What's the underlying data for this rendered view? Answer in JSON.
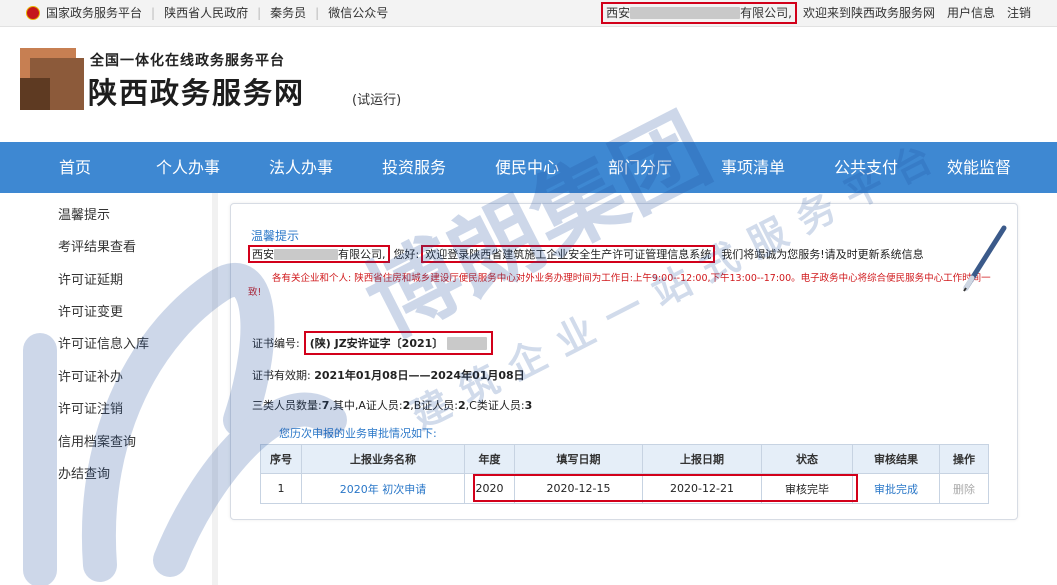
{
  "topbar": {
    "links": [
      "国家政务服务平台",
      "陕西省人民政府",
      "秦务员",
      "微信公众号"
    ],
    "company_prefix": "西安",
    "company_suffix": "有限公司,",
    "welcome": "欢迎来到陕西政务服务网",
    "user_info": "用户信息",
    "logout": "注销"
  },
  "header": {
    "subtitle": "全国一体化在线政务服务平台",
    "title": "陕西政务服务网",
    "trial": "(试运行)"
  },
  "nav": {
    "items": [
      "首页",
      "个人办事",
      "法人办事",
      "投资服务",
      "便民中心",
      "部门分厅",
      "事项清单",
      "公共支付",
      "效能监督"
    ]
  },
  "sidebar": {
    "items": [
      "温馨提示",
      "考评结果查看",
      "许可证延期",
      "许可证变更",
      "许可证信息入库",
      "许可证补办",
      "许可证注销",
      "信用档案查询",
      "办结查询"
    ]
  },
  "main": {
    "tip_title": "温馨提示",
    "company_prefix": "西安",
    "company_suffix": "有限公司,",
    "greeting": "您好:",
    "system_welcome": "欢迎登录陕西省建筑施工企业安全生产许可证管理信息系统",
    "service_text": "我们将竭诚为您服务!请及时更新系统信息",
    "notice": "各有关企业和个人: 陕西省住房和城乡建设厅便民服务中心对外业务办理时间为工作日:上午9:00--12:00,下午13:00--17:00。电子政务中心将综合便民服务中心工作时间一致!",
    "cert_label": "证书编号:",
    "cert_number": "(陕) JZ安许证字〔2021〕",
    "valid_label": "证书有效期:",
    "valid_range": "2021年01月08日——2024年01月08日",
    "counts_label": "三类人员数量:",
    "counts_total": "7",
    "counts_among": ",其中,A证人员:",
    "counts_a": "2",
    "counts_b_label": ",B证人员:",
    "counts_b": "2",
    "counts_c_label": ",C类证人员:",
    "counts_c": "3",
    "history_label": "您历次申报的业务审批情况如下:"
  },
  "table": {
    "headers": [
      "序号",
      "上报业务名称",
      "年度",
      "填写日期",
      "上报日期",
      "状态",
      "审核结果",
      "操作"
    ],
    "rows": [
      [
        "1",
        "2020年 初次申请",
        "2020",
        "2020-12-15",
        "2020-12-21",
        "审核完毕",
        "审批完成",
        "删除"
      ]
    ]
  },
  "watermark": {
    "line1": "博朗集团",
    "line2": "建筑企业一站式服务平台"
  },
  "colors": {
    "nav_bg": "#3e88d2",
    "highlight_red": "#d2001a",
    "link_blue": "#2a77c8"
  }
}
